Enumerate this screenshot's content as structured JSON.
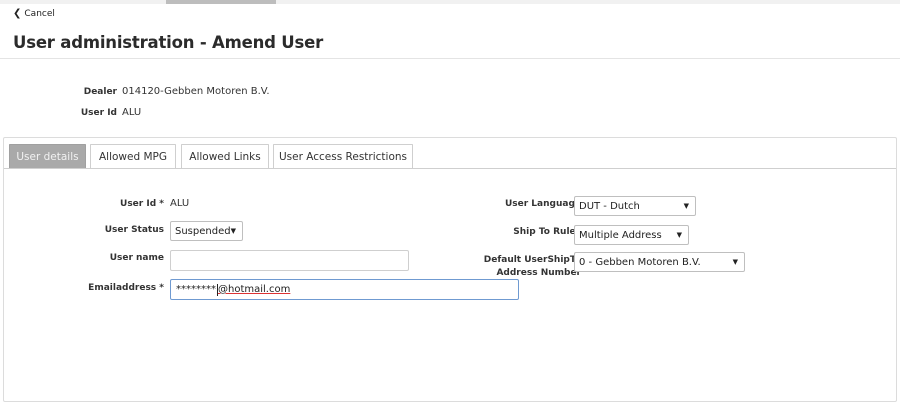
{
  "header": {
    "cancel_label": "Cancel",
    "title": "User administration - Amend User"
  },
  "info": {
    "dealer_label": "Dealer",
    "dealer_value": "014120-Gebben Motoren B.V.",
    "userid_label": "User Id",
    "userid_value": "ALU"
  },
  "tabs": [
    {
      "label": "User details",
      "active": true
    },
    {
      "label": "Allowed MPG",
      "active": false
    },
    {
      "label": "Allowed Links",
      "active": false
    },
    {
      "label": "User Access Restrictions",
      "active": false
    }
  ],
  "form": {
    "userid_label": "User Id *",
    "userid_value": "ALU",
    "status_label": "User Status",
    "status_value": "Suspended",
    "username_label": "User name",
    "username_value": "",
    "email_label": "Emailaddress *",
    "email_masked": "********",
    "email_domain": "@hotmail.com",
    "language_label": "User Language",
    "language_value": "DUT - Dutch",
    "shipto_rules_label": "Ship To Rules",
    "shipto_rules_value": "Multiple Address",
    "default_shipto_label_line1": "Default UserShipTo",
    "default_shipto_label_line2": "Address Number",
    "default_shipto_value": "0 - Gebben Motoren B.V."
  },
  "colors": {
    "active_tab_bg": "#a9a9a9",
    "focus_border": "#6f9ad1",
    "spellcheck_underline": "#dd3333"
  },
  "icons": {
    "cancel": "chevron-left-icon",
    "dropdown": "caret-down-icon"
  }
}
